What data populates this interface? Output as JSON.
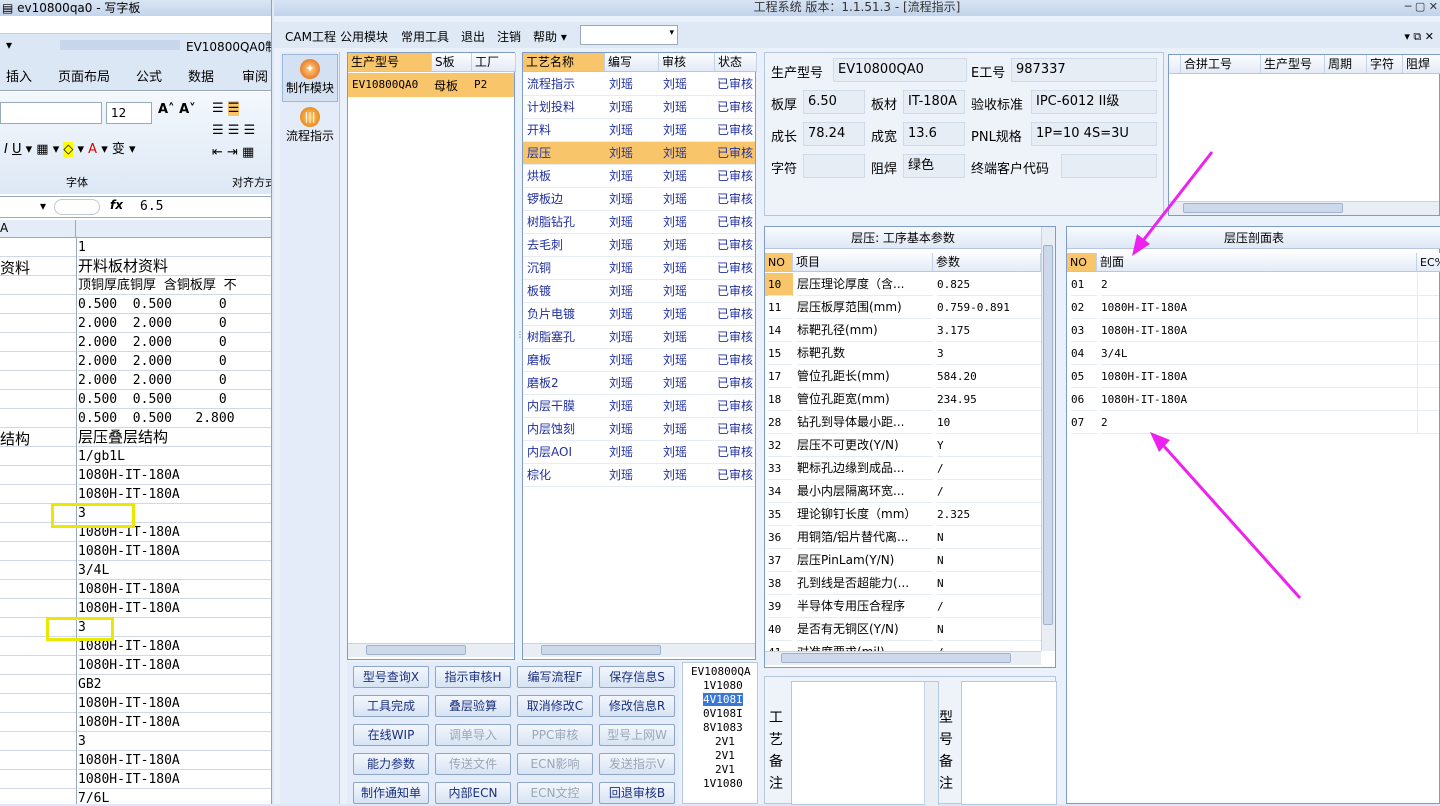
{
  "excel": {
    "title": "ev10800qa0 - 写字板",
    "cell_label": "EV10800QA0制",
    "tabs": [
      "插入",
      "页面布局",
      "公式",
      "数据",
      "审阅"
    ],
    "font_size": "12",
    "group_font": "字体",
    "group_align": "对齐方式",
    "name_box": "",
    "fx": "fx",
    "formula": "6.5",
    "col_a": "A",
    "left_labels": [
      "资料",
      "结构"
    ],
    "rows": [
      "1",
      "开料板材资料",
      "顶铜厚底铜厚 含铜板厚 不",
      "0.500  0.500      0",
      "2.000  2.000      0",
      "2.000  2.000      0",
      "2.000  2.000      0",
      "2.000  2.000      0",
      "0.500  0.500      0",
      "0.500  0.500   2.800",
      "层压叠层结构",
      "1/gb1L",
      "1080H-IT-180A",
      "1080H-IT-180A",
      "3",
      "1080H-IT-180A",
      "1080H-IT-180A",
      "3/4L",
      "1080H-IT-180A",
      "1080H-IT-180A",
      "3",
      "1080H-IT-180A",
      "1080H-IT-180A",
      "GB2",
      "1080H-IT-180A",
      "1080H-IT-180A",
      "3",
      "1080H-IT-180A",
      "1080H-IT-180A",
      "7/6L"
    ]
  },
  "app": {
    "title": "工程系统  版本：1.1.51.3 - [流程指示]",
    "menus": [
      "CAM工程",
      "公用模块",
      "常用工具",
      "退出",
      "注销",
      "帮助 ▾"
    ],
    "sidebar": [
      "制作模块",
      "流程指示"
    ],
    "models": {
      "headers": [
        "生产型号",
        "S板",
        "工厂"
      ],
      "rows": [
        [
          "EV10800QA0",
          "母板",
          "P2"
        ]
      ]
    },
    "process": {
      "headers": [
        "工艺名称",
        "编写",
        "审核",
        "状态"
      ],
      "rows": [
        [
          "流程指示",
          "刘瑶",
          "刘瑶",
          "已审核"
        ],
        [
          "计划投料",
          "刘瑶",
          "刘瑶",
          "已审核"
        ],
        [
          "开料",
          "刘瑶",
          "刘瑶",
          "已审核"
        ],
        [
          "层压",
          "刘瑶",
          "刘瑶",
          "已审核"
        ],
        [
          "烘板",
          "刘瑶",
          "刘瑶",
          "已审核"
        ],
        [
          "锣板边",
          "刘瑶",
          "刘瑶",
          "已审核"
        ],
        [
          "树脂钻孔",
          "刘瑶",
          "刘瑶",
          "已审核"
        ],
        [
          "去毛刺",
          "刘瑶",
          "刘瑶",
          "已审核"
        ],
        [
          "沉铜",
          "刘瑶",
          "刘瑶",
          "已审核"
        ],
        [
          "板镀",
          "刘瑶",
          "刘瑶",
          "已审核"
        ],
        [
          "负片电镀",
          "刘瑶",
          "刘瑶",
          "已审核"
        ],
        [
          "树脂塞孔",
          "刘瑶",
          "刘瑶",
          "已审核"
        ],
        [
          "磨板",
          "刘瑶",
          "刘瑶",
          "已审核"
        ],
        [
          "磨板2",
          "刘瑶",
          "刘瑶",
          "已审核"
        ],
        [
          "内层干膜",
          "刘瑶",
          "刘瑶",
          "已审核"
        ],
        [
          "内层蚀刻",
          "刘瑶",
          "刘瑶",
          "已审核"
        ],
        [
          "内层AOI",
          "刘瑶",
          "刘瑶",
          "已审核"
        ],
        [
          "棕化",
          "刘瑶",
          "刘瑶",
          "已审核"
        ]
      ]
    },
    "info": {
      "prod_model_label": "生产型号",
      "prod_model": "EV10800QA0",
      "e_no_label": "E工号",
      "e_no": "987337",
      "thickness_label": "板厚",
      "thickness": "6.50",
      "material_label": "板材",
      "material": "IT-180A",
      "accept_label": "验收标准",
      "accept": "IPC-6012 II级",
      "length_label": "成长",
      "length": "78.24",
      "width_label": "成宽",
      "width": "13.6",
      "pnl_label": "PNL规格",
      "pnl": "1P=10 4S=3U",
      "char_label": "字符",
      "char": "",
      "mask_label": "阻焊",
      "mask": "绿色",
      "cust_label": "终端客户代码",
      "cust": ""
    },
    "combine": {
      "headers": [
        "合拼工号",
        "生产型号",
        "周期",
        "字符",
        "阻焊"
      ]
    },
    "params": {
      "title": "层压: 工序基本参数",
      "headers": [
        "NO",
        "项目",
        "参数"
      ],
      "rows": [
        [
          "10",
          "层压理论厚度（含...",
          "0.825"
        ],
        [
          "11",
          "层压板厚范围(mm)",
          "0.759-0.891"
        ],
        [
          "14",
          "标靶孔径(mm)",
          "3.175"
        ],
        [
          "15",
          "标靶孔数",
          "3"
        ],
        [
          "17",
          "管位孔距长(mm)",
          "584.20"
        ],
        [
          "18",
          "管位孔距宽(mm)",
          "234.95"
        ],
        [
          "28",
          "钻孔到导体最小距...",
          "10"
        ],
        [
          "32",
          "层压不可更改(Y/N)",
          "Y"
        ],
        [
          "33",
          "靶标孔边缘到成品...",
          "/"
        ],
        [
          "34",
          "最小内层隔离环宽...",
          "/"
        ],
        [
          "35",
          "理论铆钉长度（mm）",
          "2.325"
        ],
        [
          "36",
          "用铜箔/铝片替代离...",
          "N"
        ],
        [
          "37",
          "层压PinLam(Y/N)",
          "N"
        ],
        [
          "38",
          "孔到线是否超能力(...",
          "N"
        ],
        [
          "39",
          "半导体专用压合程序",
          "/"
        ],
        [
          "40",
          "是否有无铜区(Y/N)",
          "N"
        ],
        [
          "41",
          "对准度要求(mil)",
          "/"
        ]
      ]
    },
    "section": {
      "title": "层压剖面表",
      "headers": [
        "NO",
        "剖面",
        "EC%"
      ],
      "rows": [
        [
          "01",
          "2"
        ],
        [
          "02",
          "1080H-IT-180A"
        ],
        [
          "03",
          "1080H-IT-180A"
        ],
        [
          "04",
          "3/4L"
        ],
        [
          "05",
          "1080H-IT-180A"
        ],
        [
          "06",
          "1080H-IT-180A"
        ],
        [
          "07",
          "2"
        ]
      ]
    },
    "buttons": [
      [
        "型号查询X",
        "指示审核H",
        "编写流程F",
        "保存信息S"
      ],
      [
        "工具完成",
        "叠层验算",
        "取消修改C",
        "修改信息R"
      ],
      [
        "在线WIP",
        "调单导入",
        "PPC审核",
        "型号上网W"
      ],
      [
        "能力参数",
        "传送文件",
        "ECN影响",
        "发送指示V"
      ],
      [
        "制作通知单",
        "内部ECN",
        "ECN文控",
        "回退审核B"
      ]
    ],
    "tree": [
      "EV10800QA",
      "1V1080",
      "4V108I",
      "0V108I",
      "8V1083",
      "2V1",
      "2V1",
      "2V1",
      "1V1080"
    ],
    "process_note_label": "工艺备注",
    "model_note_label": "型号备注"
  },
  "colors": {
    "arrow": "#ee22ee",
    "selection": "#f9c56a",
    "highlight_box": "#e8e800"
  }
}
